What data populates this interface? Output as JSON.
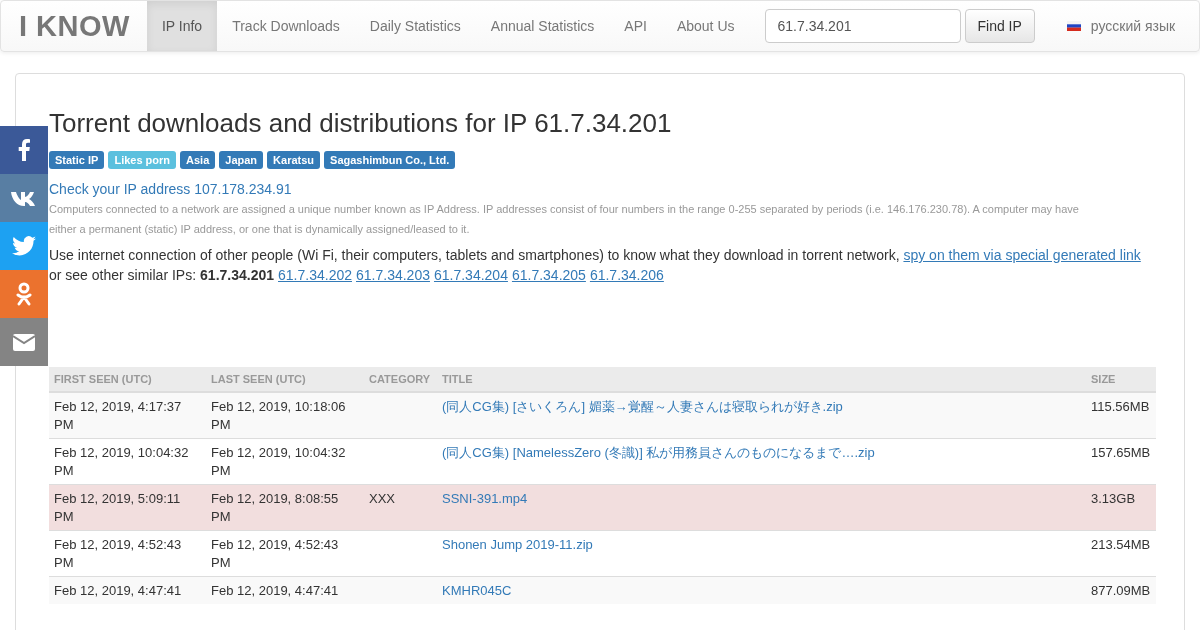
{
  "navbar": {
    "logo": "I KNOW",
    "items": [
      {
        "label": "IP Info",
        "selected": true
      },
      {
        "label": "Track Downloads",
        "selected": false
      },
      {
        "label": "Daily Statistics",
        "selected": false
      },
      {
        "label": "Annual Statistics",
        "selected": false
      },
      {
        "label": "API",
        "selected": false
      },
      {
        "label": "About Us",
        "selected": false
      }
    ],
    "search": {
      "value": "61.7.34.201"
    },
    "search_button": "Find IP",
    "language": "русский язык"
  },
  "share_buttons": [
    {
      "kind": "facebook"
    },
    {
      "kind": "vk"
    },
    {
      "kind": "twitter"
    },
    {
      "kind": "ok"
    },
    {
      "kind": "email"
    }
  ],
  "heading": "Torrent downloads and distributions for IP 61.7.34.201",
  "tags": [
    {
      "label": "Static IP",
      "color": "#337ab7"
    },
    {
      "label": "Likes porn",
      "color": "#5bc0de"
    },
    {
      "label": "Asia",
      "color": "#337ab7"
    },
    {
      "label": "Japan",
      "color": "#337ab7"
    },
    {
      "label": "Karatsu",
      "color": "#337ab7"
    },
    {
      "label": "Sagashimbun Co., Ltd.",
      "color": "#337ab7"
    }
  ],
  "check_link": "Check your IP address 107.178.234.91",
  "explanation": "Computers connected to a network are assigned a unique number known as IP Address. IP addresses consist of four numbers in the range 0-255 separated by periods (i.e. 146.176.230.78). A computer may have either a permanent (static) IP address, or one that is dynamically assigned/leased to it.",
  "intro": {
    "text": "Use internet connection of other people (Wi Fi, their computers, tablets and smartphones) to know what they download in torrent network,",
    "link": "spy on them via special generated link",
    "similar_label": "or see other similar IPs:",
    "current_ip": "61.7.34.201",
    "similar_ips": [
      "61.7.34.202",
      "61.7.34.203",
      "61.7.34.204",
      "61.7.34.205",
      "61.7.34.206"
    ]
  },
  "table": {
    "columns": [
      "FIRST SEEN (UTC)",
      "LAST SEEN (UTC)",
      "CATEGORY",
      "TITLE",
      "SIZE"
    ],
    "rows": [
      {
        "first_seen": "Feb 12, 2019, 4:17:37 PM",
        "last_seen": "Feb 12, 2019, 10:18:06 PM",
        "category": "",
        "title": "(同人CG集) [さいくろん] 媚薬→覚醒～人妻さんは寝取られが好き.zip",
        "size": "115.56MB",
        "flagged": false
      },
      {
        "first_seen": "Feb 12, 2019, 10:04:32 PM",
        "last_seen": "Feb 12, 2019, 10:04:32 PM",
        "category": "",
        "title": "(同人CG集) [NamelessZero (冬識)] 私が用務員さんのものになるまで….zip",
        "size": "157.65MB",
        "flagged": false
      },
      {
        "first_seen": "Feb 12, 2019, 5:09:11 PM",
        "last_seen": "Feb 12, 2019, 8:08:55 PM",
        "category": "XXX",
        "title": "SSNI-391.mp4",
        "size": "3.13GB",
        "flagged": true
      },
      {
        "first_seen": "Feb 12, 2019, 4:52:43 PM",
        "last_seen": "Feb 12, 2019, 4:52:43 PM",
        "category": "",
        "title": "Shonen Jump 2019-11.zip",
        "size": "213.54MB",
        "flagged": false
      },
      {
        "first_seen": "Feb 12, 2019, 4:47:41",
        "last_seen": "Feb 12, 2019, 4:47:41",
        "category": "",
        "title": "KMHR045C",
        "size": "877.09MB",
        "flagged": false
      }
    ]
  }
}
